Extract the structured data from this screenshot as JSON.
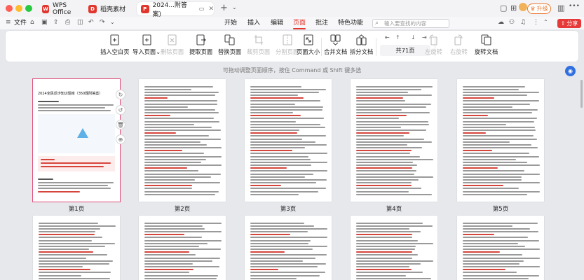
{
  "tabs": [
    {
      "label": "WPS Office"
    },
    {
      "label": "稻壳素材"
    },
    {
      "label": "2024...附答案)"
    }
  ],
  "titlebar": {
    "upgrade_label": "升级"
  },
  "menu": {
    "file_label": "文件",
    "items": [
      {
        "label": "开始"
      },
      {
        "label": "插入"
      },
      {
        "label": "编辑"
      },
      {
        "label": "页面"
      },
      {
        "label": "批注"
      },
      {
        "label": "特色功能"
      }
    ],
    "search_placeholder": "输入要查找的内容",
    "share_label": "分享"
  },
  "ribbon": {
    "tools": [
      {
        "label": "插入空白页",
        "icon": "blank-page-icon"
      },
      {
        "label": "导入页面",
        "icon": "import-page-icon"
      },
      {
        "label": "删除页面",
        "icon": "delete-page-icon"
      },
      {
        "label": "提取页面",
        "icon": "extract-page-icon"
      },
      {
        "label": "替换页面",
        "icon": "replace-page-icon"
      },
      {
        "label": "裁剪页面",
        "icon": "crop-page-icon"
      },
      {
        "label": "分割页面",
        "icon": "split-page-icon"
      },
      {
        "label": "页面大小",
        "icon": "page-size-icon"
      },
      {
        "label": "合并文档",
        "icon": "merge-doc-icon"
      },
      {
        "label": "拆分文档",
        "icon": "split-doc-icon"
      },
      {
        "label": "左旋转",
        "icon": "rotate-left-icon"
      },
      {
        "label": "右旋转",
        "icon": "rotate-right-icon"
      },
      {
        "label": "旋转文档",
        "icon": "rotate-doc-icon"
      }
    ],
    "page_count": "共71页"
  },
  "hint": "可拖动调整页面顺序，按住 Command 或 Shift 键多选",
  "pages": [
    {
      "label": "第1页",
      "title": "2024全民反诈知识题库（350题附答案）"
    },
    {
      "label": "第2页"
    },
    {
      "label": "第3页"
    },
    {
      "label": "第4页"
    },
    {
      "label": "第5页"
    }
  ],
  "colors": {
    "accent": "#e0362d",
    "red_text": "#d6453c",
    "selected_border": "#e0507a"
  }
}
